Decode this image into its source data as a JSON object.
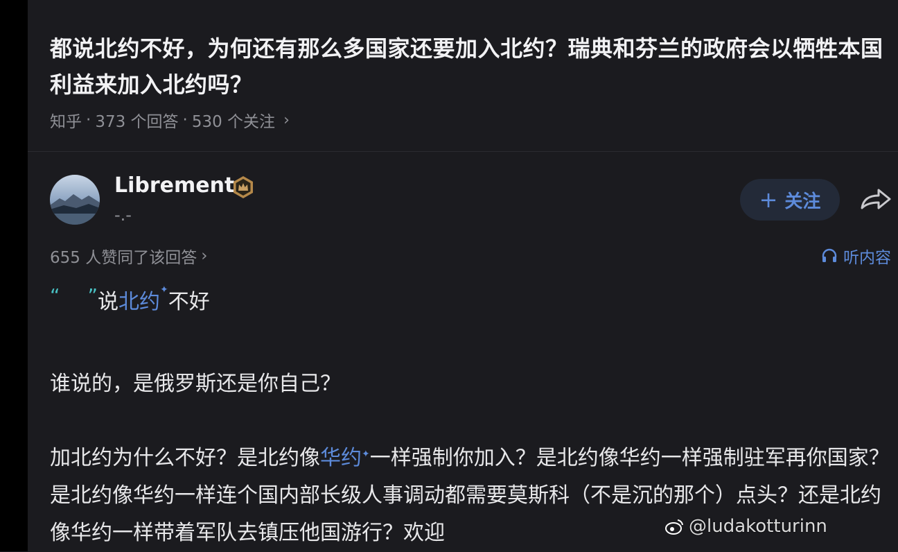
{
  "question": {
    "title": "都说北约不好，为何还有那么多国家还要加入北约？瑞典和芬兰的政府会以牺牲本国利益来加入北约吗？",
    "source": "知乎",
    "answers": "373 个回答",
    "followers": "530 个关注",
    "separator": "·"
  },
  "author": {
    "name": "Librement",
    "subtitle": "-.-",
    "follow_label": "关注"
  },
  "answer": {
    "votes_text": "655 人赞同了该回答",
    "listen_label": "听内容",
    "quote_prefix": "“",
    "quote_suffix": "”",
    "quote_text_1": "说",
    "quote_link": "北约",
    "quote_text_2": "不好",
    "para1": "谁说的，是俄罗斯还是你自己？",
    "para2_a": "加北约为什么不好？是北约像",
    "para2_link": "华约",
    "para2_b": "一样强制你加入？是北约像华约一样强制驻军再你国家？是北约像华约一样连个国内部长级人事调动都需要莫斯科（不是沉的那个）点头？还是北约像华约一样带着军队去镇压他国游行？欢迎"
  },
  "watermark": {
    "text": "@ludakotturinn"
  },
  "colors": {
    "background": "#1b1b1f",
    "accent_blue": "#5d8bdb",
    "quote_teal": "#49c2c4",
    "muted": "#8f9096"
  }
}
